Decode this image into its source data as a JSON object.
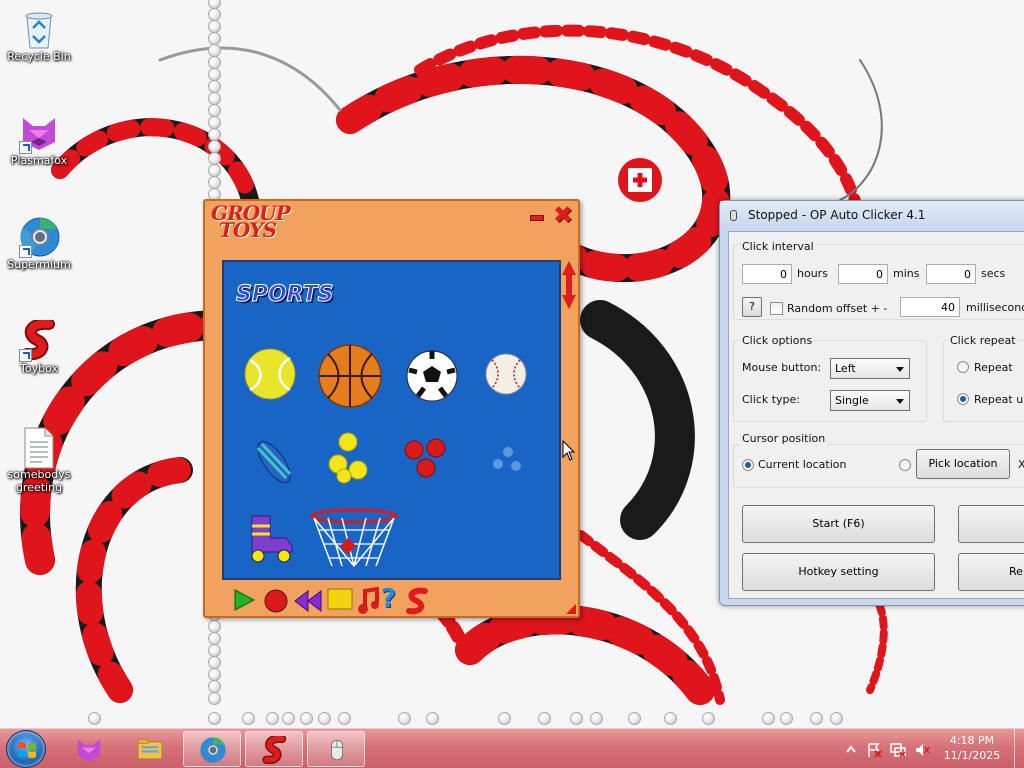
{
  "desktop": {
    "icons": [
      {
        "label": "Recycle Bin",
        "icon": "recycle-bin-icon"
      },
      {
        "label": "Plasmafox",
        "icon": "plasmafox-icon"
      },
      {
        "label": "Supermium",
        "icon": "supermium-icon"
      },
      {
        "label": "Toybox",
        "icon": "toybox-icon"
      },
      {
        "label": "somebodys greeting",
        "icon": "text-file-icon"
      }
    ]
  },
  "toybox": {
    "brand": "GROUP TOYS",
    "brand_line1": "GROUP",
    "brand_line2": "TOYS",
    "category": "SPORTS",
    "toys": [
      "tennis ball",
      "basketball",
      "soccer ball",
      "baseball",
      "striped beach ball",
      "yellow balls",
      "red balls",
      "blue balls",
      "roller skate",
      "basketball hoop"
    ],
    "controls": [
      "play-icon",
      "record-icon",
      "rewind-icon",
      "stop-icon",
      "music-icon",
      "help-icon",
      "toybox-logo-icon"
    ],
    "colors": {
      "frame": "#f1a25f",
      "stage": "#1965c6",
      "accent": "#e01b1b"
    }
  },
  "autoclicker": {
    "title": "Stopped - OP Auto Clicker 4.1",
    "click_interval": {
      "label": "Click interval",
      "hours_value": "0",
      "hours_label": "hours",
      "mins_value": "0",
      "mins_label": "mins",
      "secs_value": "0",
      "secs_label": "secs",
      "help_label": "?",
      "random_offset_label": "Random offset + -",
      "random_offset_value": "40",
      "ms_label": "milliseconds"
    },
    "click_options": {
      "label": "Click options",
      "mouse_button_label": "Mouse button:",
      "mouse_button_value": "Left",
      "click_type_label": "Click type:",
      "click_type_value": "Single"
    },
    "click_repeat": {
      "label": "Click repeat",
      "repeat_label": "Repeat",
      "repeat_until_label": "Repeat unt"
    },
    "cursor_position": {
      "label": "Cursor position",
      "current_location_label": "Current location",
      "pick_location_label": "Pick location",
      "x_label": "X"
    },
    "buttons": {
      "start": "Start (F6)",
      "hotkey": "Hotkey setting",
      "record_partial": "Re"
    }
  },
  "taskbar": {
    "pinned": [
      "plasmafox-icon",
      "file-explorer-icon",
      "supermium-icon",
      "toybox-icon",
      "mouse-icon"
    ],
    "active_index": 3,
    "clock_time": "4:18 PM",
    "clock_date": "11/1/2025",
    "tray_icons": [
      "show-hidden-icons-icon",
      "action-center-icon",
      "network-icon",
      "volume-mute-icon"
    ]
  }
}
